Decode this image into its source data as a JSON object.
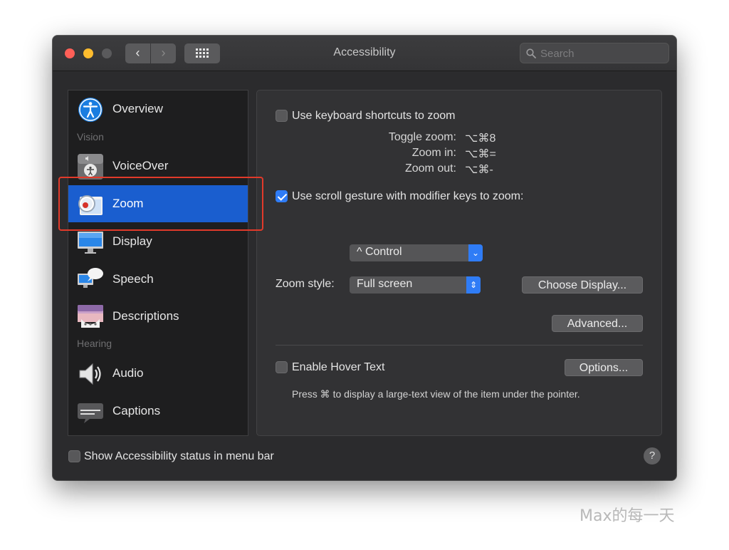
{
  "window": {
    "title": "Accessibility"
  },
  "search": {
    "placeholder": "Search"
  },
  "sidebar": {
    "items": [
      {
        "label": "Overview"
      },
      {
        "label": "VoiceOver"
      },
      {
        "label": "Zoom"
      },
      {
        "label": "Display"
      },
      {
        "label": "Speech"
      },
      {
        "label": "Descriptions"
      },
      {
        "label": "Audio"
      },
      {
        "label": "Captions"
      }
    ],
    "headers": {
      "vision": "Vision",
      "hearing": "Hearing"
    },
    "selected": "Zoom"
  },
  "zoom": {
    "keyboard_shortcuts_label": "Use keyboard shortcuts to zoom",
    "keyboard_shortcuts_checked": false,
    "shortcuts": [
      {
        "label": "Toggle zoom:",
        "keys": "⌥⌘8"
      },
      {
        "label": "Zoom in:",
        "keys": "⌥⌘="
      },
      {
        "label": "Zoom out:",
        "keys": "⌥⌘-"
      }
    ],
    "scroll_gesture_label": "Use scroll gesture with modifier keys to zoom:",
    "scroll_gesture_checked": true,
    "modifier_key": "^ Control",
    "zoom_style_label": "Zoom style:",
    "zoom_style_value": "Full screen",
    "choose_display_label": "Choose Display...",
    "advanced_label": "Advanced...",
    "hover_text_label": "Enable Hover Text",
    "hover_text_checked": false,
    "options_label": "Options...",
    "hover_note": "Press ⌘ to display a large-text view of the item under the pointer."
  },
  "footer": {
    "status_label": "Show Accessibility status in menu bar",
    "status_checked": false,
    "help_label": "?"
  },
  "watermark": "Max的每一天",
  "colors": {
    "accent": "#2f7cf6",
    "selection": "#1a5ecf",
    "highlight": "#e23a2a"
  }
}
